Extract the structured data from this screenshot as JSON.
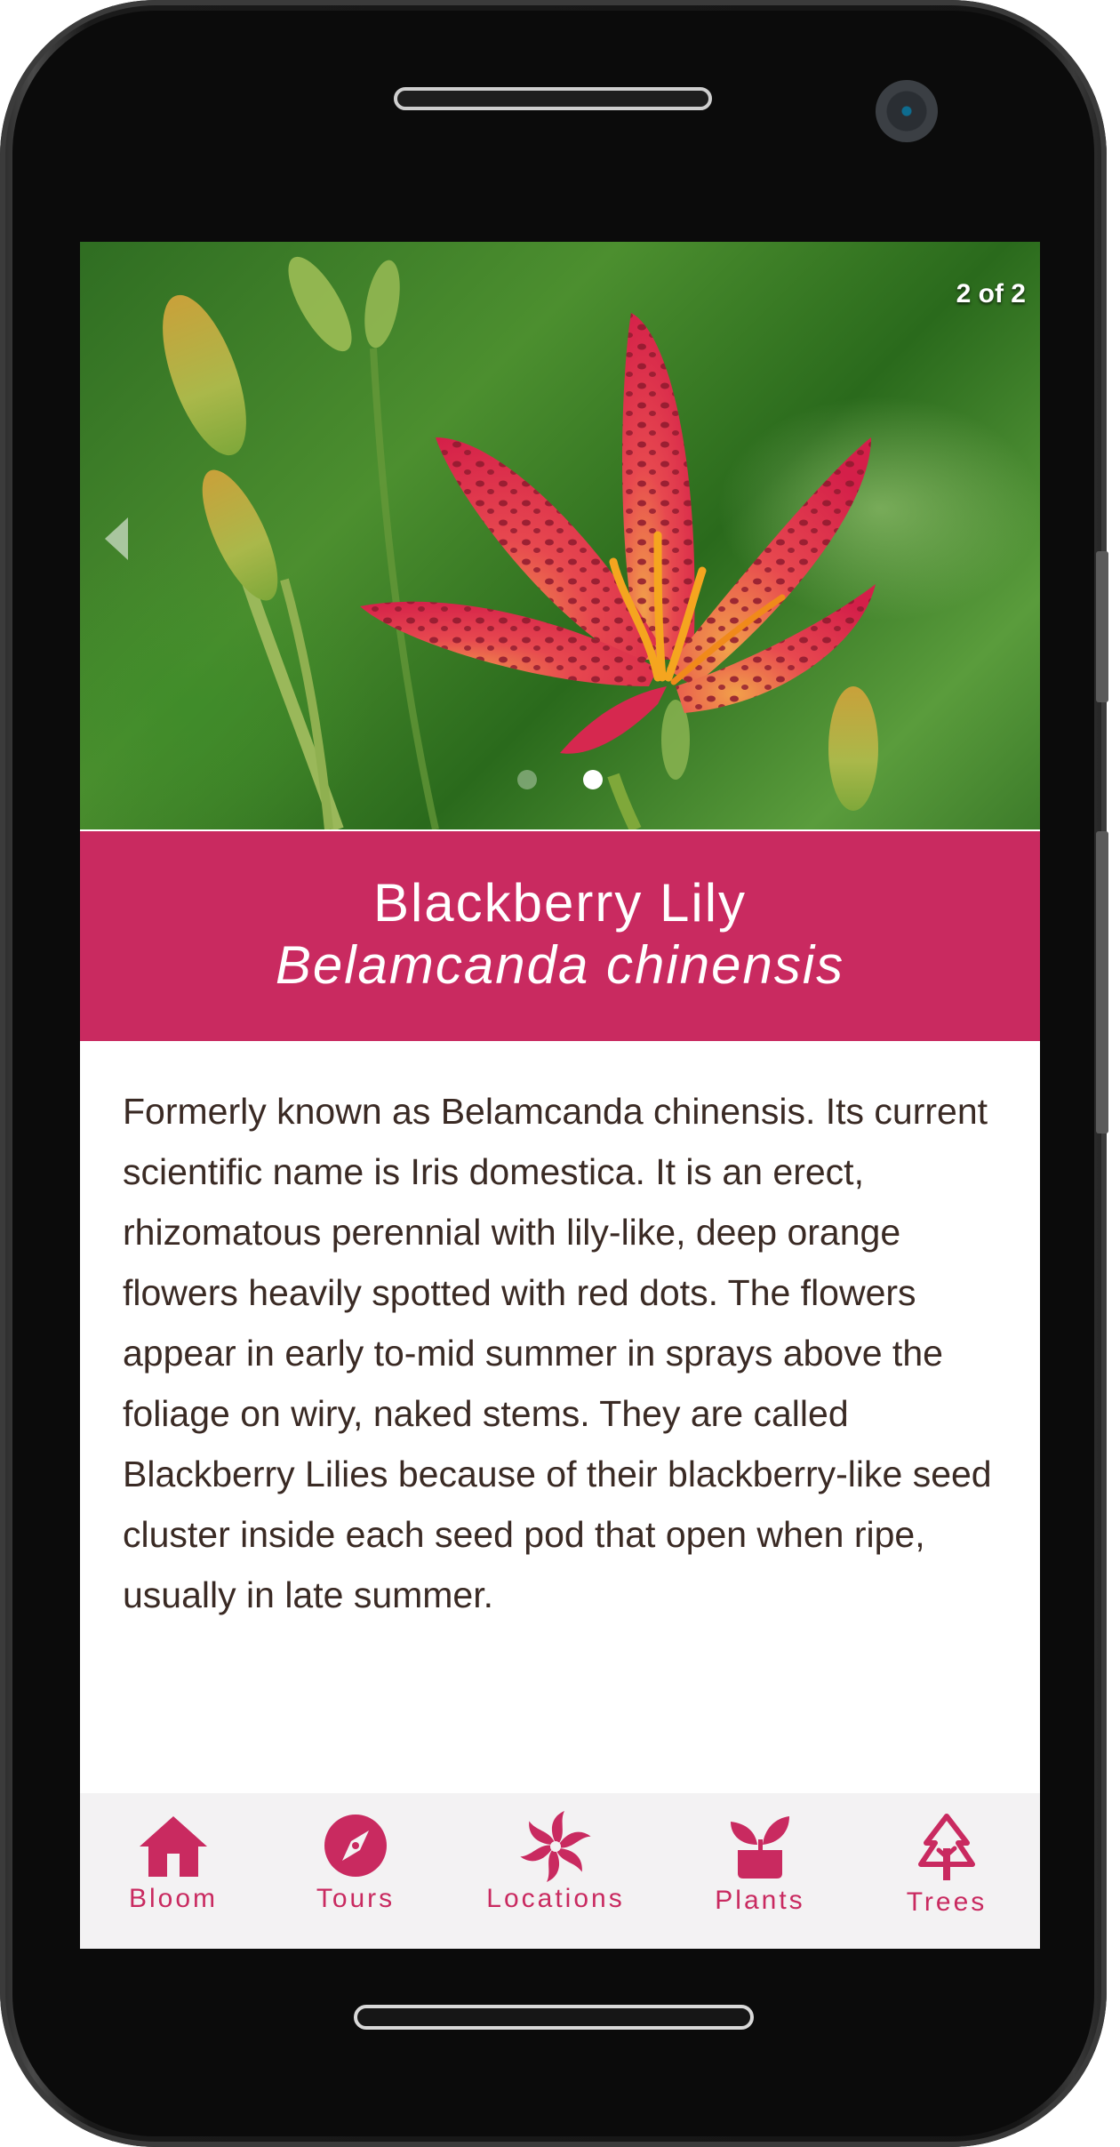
{
  "carousel": {
    "counter": "2 of 2",
    "total_slides": 2,
    "active_slide": 2
  },
  "plant": {
    "common_name": "Blackberry Lily",
    "scientific_name": "Belamcanda chinensis",
    "description": "Formerly known as Belamcanda chinensis. Its current scientific name is Iris domestica. It is an erect, rhizomatous perennial with lily-like, deep orange flowers heavily spotted with red dots. The flowers appear in early to-mid summer in sprays above the foliage on wiry, naked stems. They are called Blackberry Lilies because of their blackberry-like seed cluster inside each seed pod that open when ripe, usually in late summer."
  },
  "tabs": [
    {
      "label": "Bloom",
      "icon": "house-icon"
    },
    {
      "label": "Tours",
      "icon": "compass-icon"
    },
    {
      "label": "Locations",
      "icon": "pinwheel-icon"
    },
    {
      "label": "Plants",
      "icon": "seedling-pot-icon"
    },
    {
      "label": "Trees",
      "icon": "tree-icon"
    }
  ],
  "colors": {
    "accent": "#c92a60",
    "tabbar_bg": "#f3f2f3",
    "body_text": "#3a2a24"
  }
}
